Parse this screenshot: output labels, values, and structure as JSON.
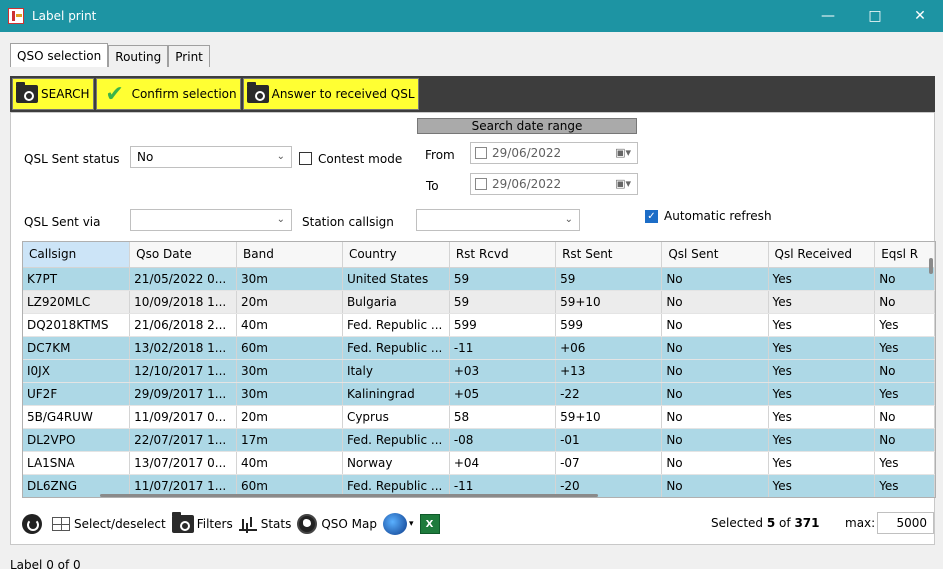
{
  "window": {
    "title": "Label print"
  },
  "tabs": [
    {
      "label": "QSO selection"
    },
    {
      "label": "Routing"
    },
    {
      "label": "Print"
    }
  ],
  "toolbar": {
    "search_label": "SEARCH",
    "confirm_label": "Confirm selection",
    "answer_label": "Answer to received QSL"
  },
  "filters": {
    "date_range_header": "Search date range",
    "qsl_sent_status_label": "QSL Sent status",
    "qsl_sent_status_value": "No",
    "contest_mode_label": "Contest mode",
    "from_label": "From",
    "from_date": "29/06/2022",
    "to_label": "To",
    "to_date": "29/06/2022",
    "qsl_sent_via_label": "QSL Sent via",
    "qsl_sent_via_value": "",
    "station_callsign_label": "Station callsign",
    "station_callsign_value": "",
    "auto_refresh_label": "Automatic refresh",
    "auto_refresh_checked": true
  },
  "grid": {
    "columns": [
      "Callsign",
      "Qso Date",
      "Band",
      "Country",
      "Rst Rcvd",
      "Rst Sent",
      "Qsl Sent",
      "Qsl Received",
      "Eqsl R"
    ],
    "rows": [
      {
        "style": "blue",
        "cells": [
          "K7PT",
          "21/05/2022 0...",
          "30m",
          "United States",
          "59",
          "59",
          "No",
          "Yes",
          "No"
        ]
      },
      {
        "style": "gray",
        "cells": [
          "LZ920MLC",
          "10/09/2018 1...",
          "20m",
          "Bulgaria",
          "59",
          "59+10",
          "No",
          "Yes",
          "No"
        ]
      },
      {
        "style": "white",
        "cells": [
          "DQ2018KTMS",
          "21/06/2018 2...",
          "40m",
          "Fed. Republic ...",
          "599",
          "599",
          "No",
          "Yes",
          "Yes"
        ]
      },
      {
        "style": "blue",
        "cells": [
          "DC7KM",
          "13/02/2018 1...",
          "60m",
          "Fed. Republic ...",
          "-11",
          "+06",
          "No",
          "Yes",
          "Yes"
        ]
      },
      {
        "style": "blue",
        "cells": [
          "I0JX",
          "12/10/2017 1...",
          "30m",
          "Italy",
          "+03",
          "+13",
          "No",
          "Yes",
          "No"
        ]
      },
      {
        "style": "blue",
        "cells": [
          "UF2F",
          "29/09/2017 1...",
          "30m",
          "Kaliningrad",
          "+05",
          "-22",
          "No",
          "Yes",
          "Yes"
        ]
      },
      {
        "style": "white",
        "cells": [
          "5B/G4RUW",
          "11/09/2017 0...",
          "20m",
          "Cyprus",
          "58",
          "59+10",
          "No",
          "Yes",
          "No"
        ]
      },
      {
        "style": "blue",
        "cells": [
          "DL2VPO",
          "22/07/2017 1...",
          "17m",
          "Fed. Republic ...",
          "-08",
          "-01",
          "No",
          "Yes",
          "No"
        ]
      },
      {
        "style": "white",
        "cells": [
          "LA1SNA",
          "13/07/2017 0...",
          "40m",
          "Norway",
          "+04",
          "-07",
          "No",
          "Yes",
          "Yes"
        ]
      },
      {
        "style": "blue",
        "cells": [
          "DL6ZNG",
          "11/07/2017 1...",
          "60m",
          "Fed. Republic ...",
          "-11",
          "-20",
          "No",
          "Yes",
          "Yes"
        ]
      }
    ]
  },
  "bottombar": {
    "select_deselect_label": "Select/deselect",
    "filters_label": "Filters",
    "stats_label": "Stats",
    "qso_map_label": "QSO Map",
    "excel_label": "X",
    "selected_prefix": "Selected",
    "selected_count": "5",
    "of_label": "of",
    "total_count": "371",
    "max_label": "max:",
    "max_value": "5000"
  },
  "status": {
    "text": "Label  0  of  0"
  }
}
